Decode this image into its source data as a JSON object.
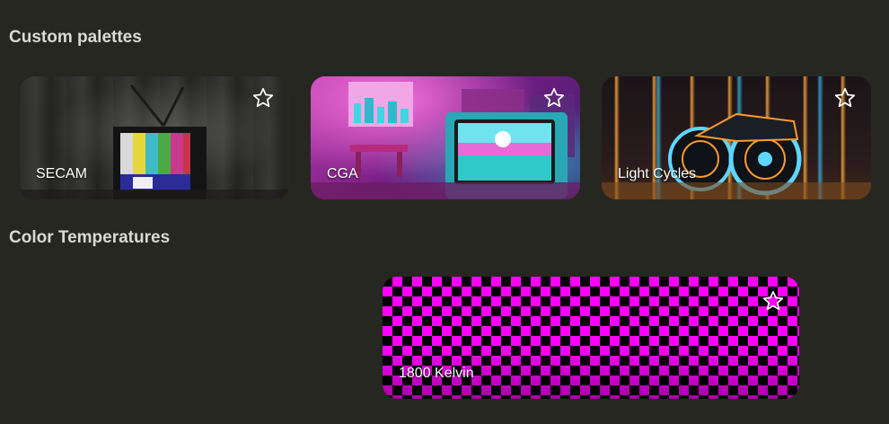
{
  "sections": {
    "custom": {
      "title": "Custom palettes",
      "cards": [
        {
          "label": "SECAM"
        },
        {
          "label": "CGA"
        },
        {
          "label": "Light Cycles"
        }
      ]
    },
    "temperatures": {
      "title": "Color Temperatures",
      "cards": [
        {
          "label": "1800 Kelvin"
        }
      ]
    }
  },
  "icons": {
    "favorite": "star-outline-icon"
  },
  "colors": {
    "background": "#272721",
    "section_title": "#d9d9d5",
    "card_label": "#ffffff",
    "checker_magenta": "#ff00ff",
    "checker_dark": "#000000"
  }
}
